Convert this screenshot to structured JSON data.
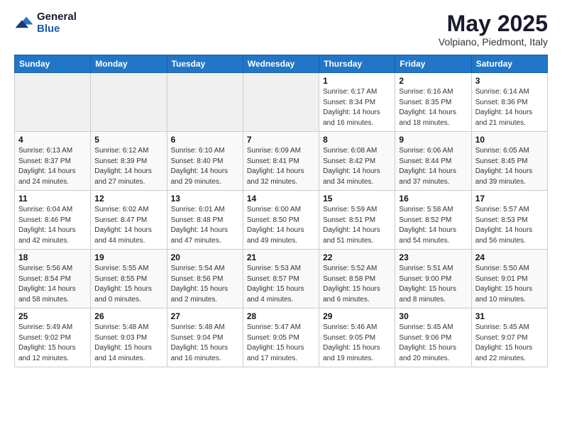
{
  "header": {
    "logo_general": "General",
    "logo_blue": "Blue",
    "title": "May 2025",
    "location": "Volpiano, Piedmont, Italy"
  },
  "weekdays": [
    "Sunday",
    "Monday",
    "Tuesday",
    "Wednesday",
    "Thursday",
    "Friday",
    "Saturday"
  ],
  "weeks": [
    [
      {
        "day": "",
        "info": ""
      },
      {
        "day": "",
        "info": ""
      },
      {
        "day": "",
        "info": ""
      },
      {
        "day": "",
        "info": ""
      },
      {
        "day": "1",
        "info": "Sunrise: 6:17 AM\nSunset: 8:34 PM\nDaylight: 14 hours\nand 16 minutes."
      },
      {
        "day": "2",
        "info": "Sunrise: 6:16 AM\nSunset: 8:35 PM\nDaylight: 14 hours\nand 18 minutes."
      },
      {
        "day": "3",
        "info": "Sunrise: 6:14 AM\nSunset: 8:36 PM\nDaylight: 14 hours\nand 21 minutes."
      }
    ],
    [
      {
        "day": "4",
        "info": "Sunrise: 6:13 AM\nSunset: 8:37 PM\nDaylight: 14 hours\nand 24 minutes."
      },
      {
        "day": "5",
        "info": "Sunrise: 6:12 AM\nSunset: 8:39 PM\nDaylight: 14 hours\nand 27 minutes."
      },
      {
        "day": "6",
        "info": "Sunrise: 6:10 AM\nSunset: 8:40 PM\nDaylight: 14 hours\nand 29 minutes."
      },
      {
        "day": "7",
        "info": "Sunrise: 6:09 AM\nSunset: 8:41 PM\nDaylight: 14 hours\nand 32 minutes."
      },
      {
        "day": "8",
        "info": "Sunrise: 6:08 AM\nSunset: 8:42 PM\nDaylight: 14 hours\nand 34 minutes."
      },
      {
        "day": "9",
        "info": "Sunrise: 6:06 AM\nSunset: 8:44 PM\nDaylight: 14 hours\nand 37 minutes."
      },
      {
        "day": "10",
        "info": "Sunrise: 6:05 AM\nSunset: 8:45 PM\nDaylight: 14 hours\nand 39 minutes."
      }
    ],
    [
      {
        "day": "11",
        "info": "Sunrise: 6:04 AM\nSunset: 8:46 PM\nDaylight: 14 hours\nand 42 minutes."
      },
      {
        "day": "12",
        "info": "Sunrise: 6:02 AM\nSunset: 8:47 PM\nDaylight: 14 hours\nand 44 minutes."
      },
      {
        "day": "13",
        "info": "Sunrise: 6:01 AM\nSunset: 8:48 PM\nDaylight: 14 hours\nand 47 minutes."
      },
      {
        "day": "14",
        "info": "Sunrise: 6:00 AM\nSunset: 8:50 PM\nDaylight: 14 hours\nand 49 minutes."
      },
      {
        "day": "15",
        "info": "Sunrise: 5:59 AM\nSunset: 8:51 PM\nDaylight: 14 hours\nand 51 minutes."
      },
      {
        "day": "16",
        "info": "Sunrise: 5:58 AM\nSunset: 8:52 PM\nDaylight: 14 hours\nand 54 minutes."
      },
      {
        "day": "17",
        "info": "Sunrise: 5:57 AM\nSunset: 8:53 PM\nDaylight: 14 hours\nand 56 minutes."
      }
    ],
    [
      {
        "day": "18",
        "info": "Sunrise: 5:56 AM\nSunset: 8:54 PM\nDaylight: 14 hours\nand 58 minutes."
      },
      {
        "day": "19",
        "info": "Sunrise: 5:55 AM\nSunset: 8:55 PM\nDaylight: 15 hours\nand 0 minutes."
      },
      {
        "day": "20",
        "info": "Sunrise: 5:54 AM\nSunset: 8:56 PM\nDaylight: 15 hours\nand 2 minutes."
      },
      {
        "day": "21",
        "info": "Sunrise: 5:53 AM\nSunset: 8:57 PM\nDaylight: 15 hours\nand 4 minutes."
      },
      {
        "day": "22",
        "info": "Sunrise: 5:52 AM\nSunset: 8:58 PM\nDaylight: 15 hours\nand 6 minutes."
      },
      {
        "day": "23",
        "info": "Sunrise: 5:51 AM\nSunset: 9:00 PM\nDaylight: 15 hours\nand 8 minutes."
      },
      {
        "day": "24",
        "info": "Sunrise: 5:50 AM\nSunset: 9:01 PM\nDaylight: 15 hours\nand 10 minutes."
      }
    ],
    [
      {
        "day": "25",
        "info": "Sunrise: 5:49 AM\nSunset: 9:02 PM\nDaylight: 15 hours\nand 12 minutes."
      },
      {
        "day": "26",
        "info": "Sunrise: 5:48 AM\nSunset: 9:03 PM\nDaylight: 15 hours\nand 14 minutes."
      },
      {
        "day": "27",
        "info": "Sunrise: 5:48 AM\nSunset: 9:04 PM\nDaylight: 15 hours\nand 16 minutes."
      },
      {
        "day": "28",
        "info": "Sunrise: 5:47 AM\nSunset: 9:05 PM\nDaylight: 15 hours\nand 17 minutes."
      },
      {
        "day": "29",
        "info": "Sunrise: 5:46 AM\nSunset: 9:05 PM\nDaylight: 15 hours\nand 19 minutes."
      },
      {
        "day": "30",
        "info": "Sunrise: 5:45 AM\nSunset: 9:06 PM\nDaylight: 15 hours\nand 20 minutes."
      },
      {
        "day": "31",
        "info": "Sunrise: 5:45 AM\nSunset: 9:07 PM\nDaylight: 15 hours\nand 22 minutes."
      }
    ]
  ]
}
